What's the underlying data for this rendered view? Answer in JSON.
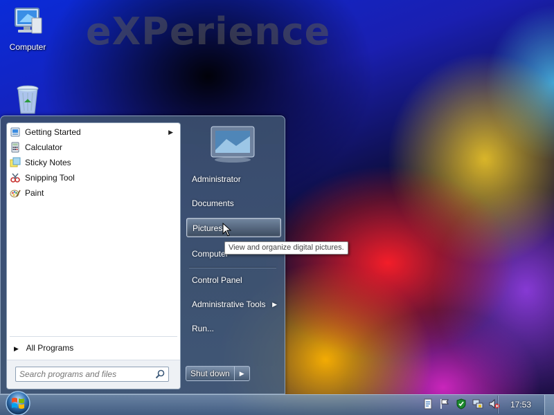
{
  "desktop": {
    "watermark": "eXPerience",
    "icons": [
      {
        "label": "Computer",
        "icon": "computer-icon"
      },
      {
        "label": "",
        "icon": "recycle-bin-icon"
      }
    ]
  },
  "start_menu": {
    "programs": [
      {
        "label": "Getting Started",
        "icon": "getting-started-icon",
        "has_submenu": true
      },
      {
        "label": "Calculator",
        "icon": "calculator-icon",
        "has_submenu": false
      },
      {
        "label": "Sticky Notes",
        "icon": "sticky-notes-icon",
        "has_submenu": false
      },
      {
        "label": "Snipping Tool",
        "icon": "snipping-tool-icon",
        "has_submenu": false
      },
      {
        "label": "Paint",
        "icon": "paint-icon",
        "has_submenu": false
      }
    ],
    "all_programs": "All Programs",
    "search": {
      "placeholder": "Search programs and files",
      "value": ""
    },
    "right_items": [
      {
        "label": "Administrator"
      },
      {
        "label": "Documents"
      },
      {
        "label": "Pictures",
        "hovered": true
      },
      {
        "label": "Computer"
      },
      {
        "label": "Control Panel"
      },
      {
        "label": "Administrative Tools",
        "has_submenu": true
      },
      {
        "label": "Run..."
      }
    ],
    "shutdown_label": "Shut down",
    "tooltip": "View and organize digital pictures."
  },
  "taskbar": {
    "tray_icons": [
      "action-center-icon",
      "flag-icon",
      "security-shield-icon",
      "network-icon",
      "volume-muted-icon"
    ],
    "clock": "17:53"
  },
  "colors": {
    "menu_frame": "#4a607e",
    "hover_highlight": "#5f7693",
    "taskbar": "#5d7f9f"
  }
}
